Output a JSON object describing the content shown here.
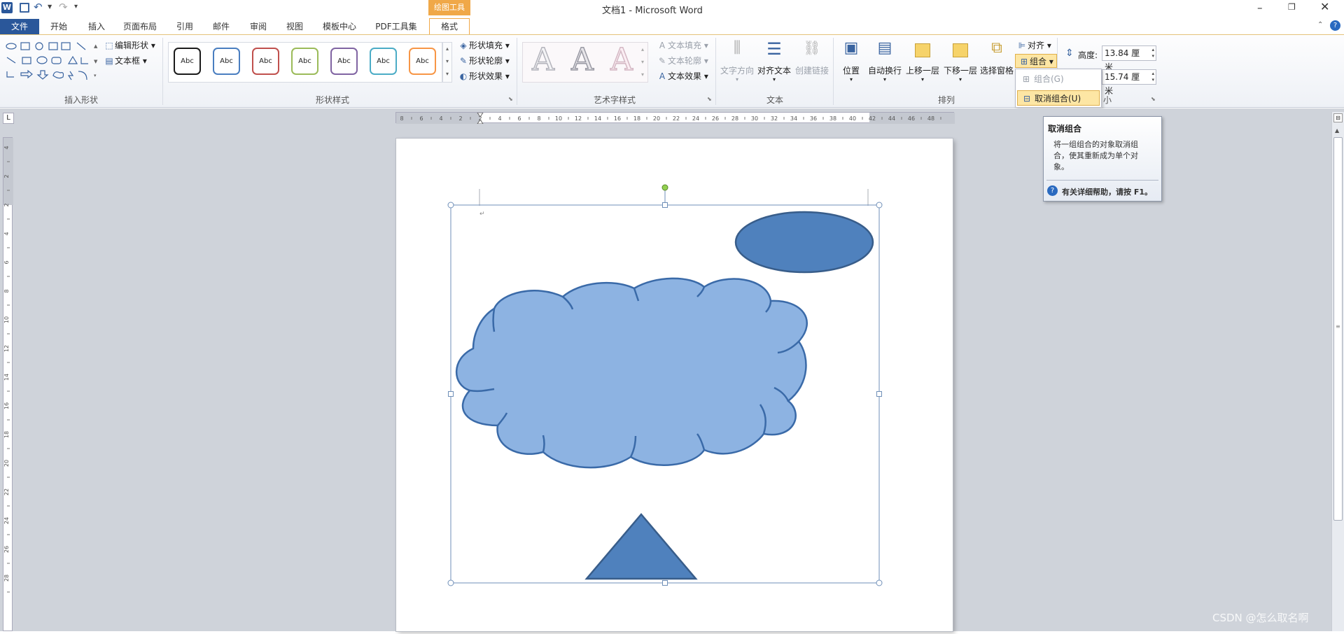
{
  "window": {
    "title": "文档1 - Microsoft Word",
    "contextual_tab_group": "绘图工具"
  },
  "tabs": [
    {
      "label": "文件",
      "active": false,
      "file": true
    },
    {
      "label": "开始"
    },
    {
      "label": "插入"
    },
    {
      "label": "页面布局"
    },
    {
      "label": "引用"
    },
    {
      "label": "邮件"
    },
    {
      "label": "审阅"
    },
    {
      "label": "视图"
    },
    {
      "label": "模板中心"
    },
    {
      "label": "PDF工具集"
    },
    {
      "label": "格式",
      "active": true
    }
  ],
  "ribbon": {
    "insert_shapes": {
      "label": "插入形状",
      "edit_shape": "编辑形状",
      "text_box": "文本框"
    },
    "shape_styles": {
      "label": "形状样式",
      "style_text": "Abc",
      "style_colors": [
        "#1b1b1b",
        "#4a7ec0",
        "#c0504d",
        "#9bbb59",
        "#8064a2",
        "#4bacc6",
        "#f79646"
      ],
      "shape_fill": "形状填充",
      "shape_outline": "形状轮廓",
      "shape_effects": "形状效果"
    },
    "wordart": {
      "label": "艺术字样式",
      "letter": "A",
      "text_fill": "文本填充",
      "text_outline": "文本轮廓",
      "text_effects": "文本效果"
    },
    "text": {
      "label": "文本",
      "text_direction": "文字方向",
      "align_text": "对齐文本",
      "create_link": "创建链接"
    },
    "arrange": {
      "label": "排列",
      "position": "位置",
      "wrap_text": "自动换行",
      "bring_forward": "上移一层",
      "send_backward": "下移一层",
      "selection_pane": "选择窗格",
      "align": "对齐",
      "group": "组合"
    },
    "size": {
      "label_partial": "小",
      "height_label": "高度:",
      "height_value": "13.84 厘米",
      "width_value": "15.74 厘米"
    }
  },
  "group_dropdown": {
    "items": [
      {
        "label": "组合(G)",
        "disabled": true
      },
      {
        "label": "取消组合(U)",
        "highlighted": true
      }
    ]
  },
  "tooltip": {
    "title": "取消组合",
    "body": "将一组组合的对象取消组合，使其重新成为单个对象。",
    "help": "有关详细帮助，请按 F1。"
  },
  "ruler": {
    "h_labels": [
      "8",
      "6",
      "4",
      "2",
      "2",
      "4",
      "6",
      "8",
      "10",
      "12",
      "14",
      "16",
      "18",
      "20",
      "22",
      "24",
      "26",
      "28",
      "30",
      "32",
      "34",
      "36",
      "38",
      "40",
      "42",
      "44",
      "46",
      "48"
    ],
    "v_labels": [
      "4",
      "2",
      "2",
      "4",
      "6",
      "8",
      "10",
      "12",
      "14",
      "16",
      "18",
      "20",
      "22",
      "24",
      "26",
      "28"
    ]
  },
  "watermark": "CSDN @怎么取名啊",
  "colors": {
    "file_tab": "#2a579a",
    "accent_orange": "#f0a848",
    "shape_dark": "#4f81bd",
    "shape_light": "#8db3e2",
    "shape_stroke": "#3a64a0",
    "highlight": "#fde6a4"
  }
}
